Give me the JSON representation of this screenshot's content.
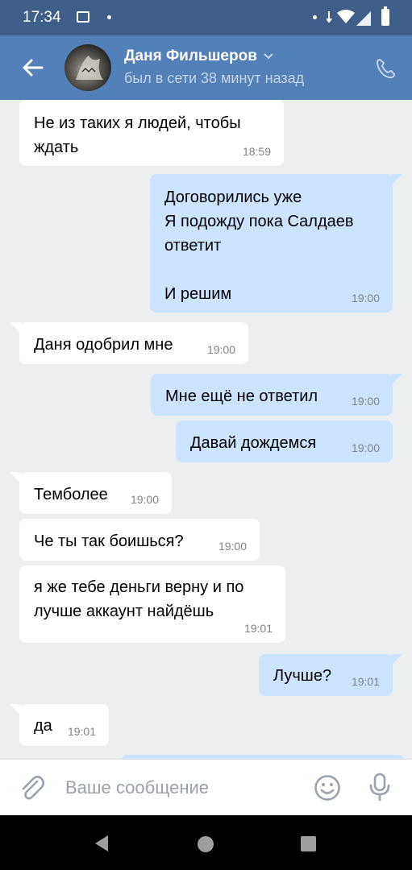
{
  "status_bar": {
    "time": "17:34"
  },
  "header": {
    "contact_name": "Даня Фильшеров",
    "last_seen": "был в сети 38 минут назад"
  },
  "messages": [
    {
      "direction": "in",
      "text": "Не из таких я людей, чтобы\nждать",
      "time": "18:59"
    },
    {
      "direction": "out",
      "text": "Договорились уже\nЯ подожду пока Салдаев\nответит\n\nИ решим",
      "time": "19:00"
    },
    {
      "direction": "in",
      "text": "Даня одобрил мне",
      "time": "19:00"
    },
    {
      "direction": "out",
      "text": "Мне ещё не ответил",
      "time": "19:00"
    },
    {
      "direction": "out",
      "text": "Давай дождемся",
      "time": "19:00"
    },
    {
      "direction": "in",
      "text": "Темболее",
      "time": "19:00"
    },
    {
      "direction": "in",
      "text": "Че ты так боишься?",
      "time": "19:00"
    },
    {
      "direction": "in",
      "text": "я же тебе деньги верну и по\nлучше аккаунт найдёшь",
      "time": "19:01"
    },
    {
      "direction": "out",
      "text": "Лучше?",
      "time": "19:01"
    },
    {
      "direction": "in",
      "text": "да",
      "time": "19:01"
    }
  ],
  "composer": {
    "placeholder": "Ваше сообщение"
  },
  "icons": {
    "back": "arrow-left-icon",
    "phone": "phone-icon",
    "attach": "paperclip-icon",
    "emoji": "smile-icon",
    "mic": "microphone-icon"
  },
  "colors": {
    "header": "#5181b8",
    "status_bar": "#3f5f8a",
    "incoming_bubble": "#ffffff",
    "outgoing_bubble": "#cce4ff",
    "chat_background": "#edeef0"
  }
}
